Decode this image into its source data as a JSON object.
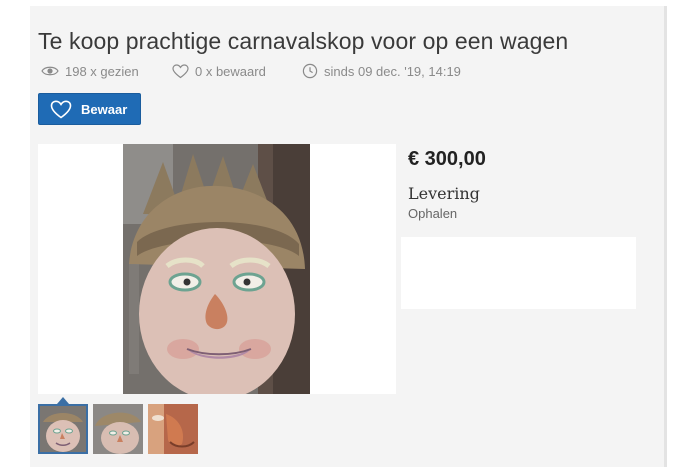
{
  "listing": {
    "title": "Te koop prachtige carnavalskop voor op een wagen",
    "views": "198 x gezien",
    "saved": "0 x bewaard",
    "since": "sinds 09 dec. '19, 14:19",
    "save_button": "Bewaar",
    "price": "€ 300,00",
    "delivery_label": "Levering",
    "delivery_value": "Ophalen"
  },
  "icons": {
    "views": "eye-icon",
    "saved": "heart-outline-icon",
    "since": "clock-icon",
    "save_button": "heart-outline-icon"
  },
  "colors": {
    "accent": "#1f6bb5",
    "panel": "#f4f4f4",
    "text": "#3a3a3a",
    "muted": "#8a8a8a"
  },
  "gallery": {
    "main_image": "carnival-head-photo",
    "thumbnails": [
      "carnival-head-front-thumb",
      "carnival-head-side-thumb",
      "carnival-head-closeup-thumb"
    ],
    "selected_index": 0
  }
}
